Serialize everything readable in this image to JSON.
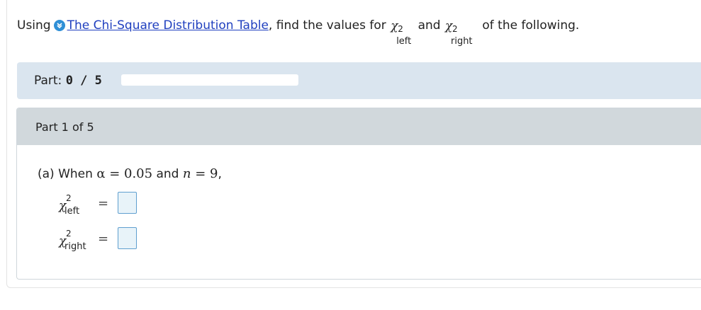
{
  "question": {
    "prefix": "Using",
    "link_text": "The Chi-Square Distribution Table",
    "mid": ", find the values for",
    "and": "and",
    "suffix": "of the following.",
    "chi_symbol": "χ",
    "superscript": "2",
    "left_sub": "left",
    "right_sub": "right"
  },
  "progress": {
    "label_prefix": "Part:",
    "label_value": "0 / 5",
    "completed_fraction": 0,
    "fill_color": "#2f8fd6"
  },
  "part": {
    "header": "Part 1 of 5",
    "prompt_prefix": "(a) When",
    "alpha_expr": "α = 0.05",
    "and": "and",
    "n_var": "n",
    "n_expr": " = 9",
    "prompt_suffix": ",",
    "equals": "=",
    "inputs": {
      "left_value": "",
      "right_value": ""
    }
  },
  "icons": {
    "ebook": "ebook-chevron-icon"
  },
  "colors": {
    "accent": "#2f8fd6",
    "link": "#1f3fbf",
    "part_bar_bg": "#dae5ef",
    "part_header_bg": "#d1d8dc"
  }
}
